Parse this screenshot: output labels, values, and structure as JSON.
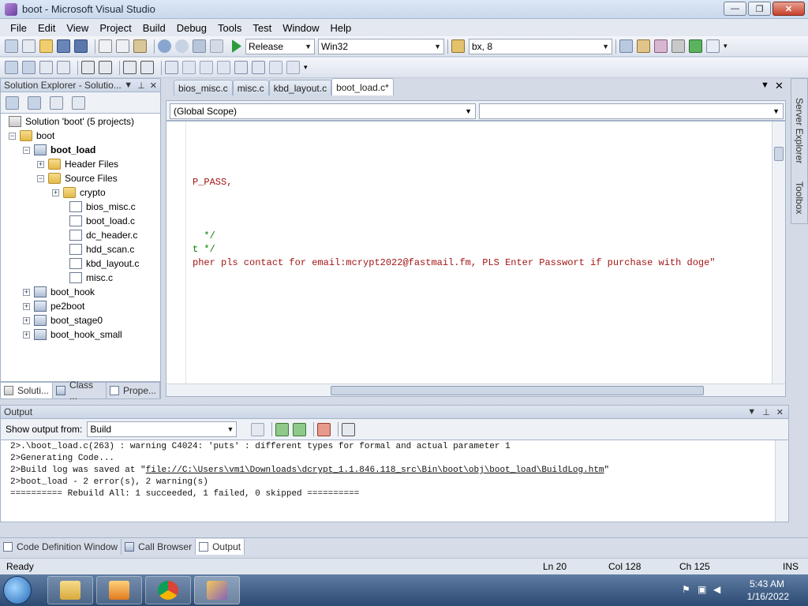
{
  "window": {
    "title": "boot - Microsoft Visual Studio",
    "min": "—",
    "max": "❐",
    "close": "✕"
  },
  "menu": [
    "File",
    "Edit",
    "View",
    "Project",
    "Build",
    "Debug",
    "Tools",
    "Test",
    "Window",
    "Help"
  ],
  "toolbar": {
    "configuration": "Release",
    "platform": "Win32",
    "find_text": "bx, 8"
  },
  "solution_explorer": {
    "header": "Solution Explorer - Solutio...",
    "items": [
      {
        "label": "Solution 'boot' (5 projects)",
        "kind": "solution"
      },
      {
        "label": "boot",
        "kind": "folder",
        "expander": "−"
      },
      {
        "label": "boot_load",
        "kind": "project",
        "expander": "−"
      },
      {
        "label": "Header Files",
        "kind": "folder",
        "expander": "+"
      },
      {
        "label": "Source Files",
        "kind": "folder",
        "expander": "−"
      },
      {
        "label": "crypto",
        "kind": "folder",
        "expander": "+"
      },
      {
        "label": "bios_misc.c",
        "kind": "file"
      },
      {
        "label": "boot_load.c",
        "kind": "file"
      },
      {
        "label": "dc_header.c",
        "kind": "file"
      },
      {
        "label": "hdd_scan.c",
        "kind": "file"
      },
      {
        "label": "kbd_layout.c",
        "kind": "file"
      },
      {
        "label": "misc.c",
        "kind": "file"
      },
      {
        "label": "boot_hook",
        "kind": "project",
        "expander": "+"
      },
      {
        "label": "pe2boot",
        "kind": "project",
        "expander": "+"
      },
      {
        "label": "boot_stage0",
        "kind": "project",
        "expander": "+"
      },
      {
        "label": "boot_hook_small",
        "kind": "project",
        "expander": "+"
      }
    ],
    "tabs": [
      "Soluti...",
      "Class ...",
      "Prope..."
    ]
  },
  "editor": {
    "tabs": [
      "bios_misc.c",
      "misc.c",
      "kbd_layout.c",
      "boot_load.c*"
    ],
    "scope": "(Global Scope)",
    "member": "",
    "lines": [
      {
        "text": "P_PASS,",
        "kind": "string"
      },
      {
        "text": "  */",
        "kind": "comment"
      },
      {
        "text": "t */",
        "kind": "comment"
      },
      {
        "text": "pher pls contact for email:mcrypt2022@fastmail.fm, PLS Enter Passwort if purchase with doge\"",
        "kind": "string"
      }
    ]
  },
  "side_panels": [
    "Server Explorer",
    "Toolbox"
  ],
  "output": {
    "header": "Output",
    "show_from_label": "Show output from:",
    "show_from_value": "Build",
    "lines": [
      "2>.\\boot_load.c(263) : warning C4024: 'puts' : different types for formal and actual parameter 1",
      "2>Generating Code...",
      "2>Build log was saved at \"",
      "2>boot_load - 2 error(s), 2 warning(s)",
      "========== Rebuild All: 1 succeeded, 1 failed, 0 skipped =========="
    ],
    "log_link": "file://C:\\Users\\vm1\\Downloads\\dcrypt_1.1.846.118_src\\Bin\\boot\\obj\\boot_load\\BuildLog.htm",
    "log_suffix": "\"",
    "tabs": [
      "Code Definition Window",
      "Call Browser",
      "Output"
    ]
  },
  "status": {
    "ready": "Ready",
    "ln": "Ln 20",
    "col": "Col 128",
    "ch": "Ch 125",
    "ins": "INS"
  },
  "taskbar": {
    "time": "5:43 AM",
    "date": "1/16/2022"
  },
  "colors": {
    "code_string": "#a31515",
    "code_comment": "#008000",
    "title_bar": "#c9d8ec"
  }
}
